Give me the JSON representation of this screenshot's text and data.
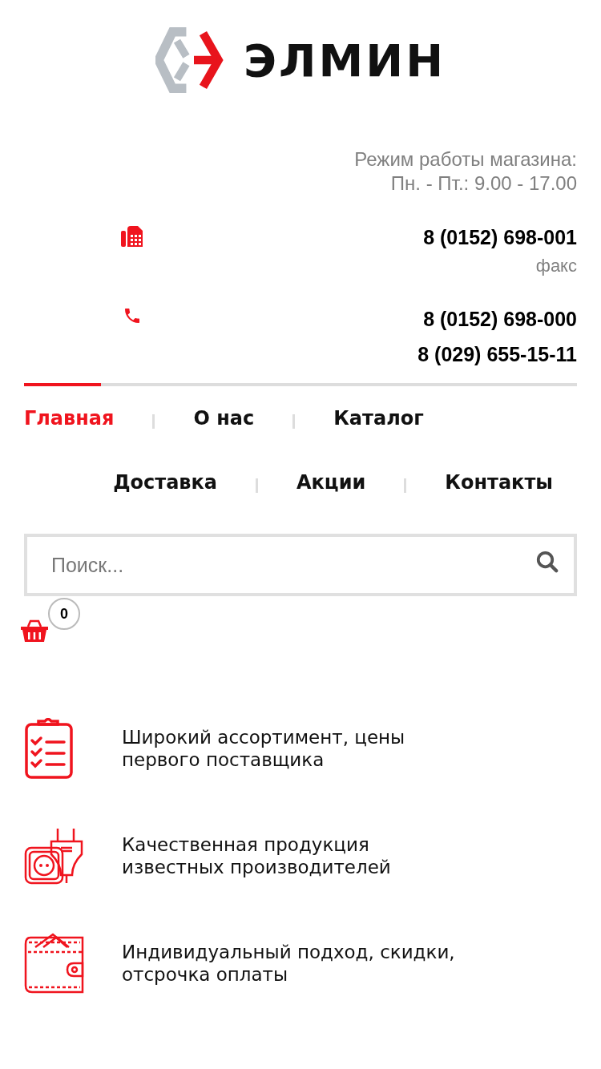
{
  "logo": {
    "text": "ЭЛМИН"
  },
  "hours": {
    "label": "Режим работы магазина:",
    "value": "Пн. - Пт.: 9.00 - 17.00"
  },
  "contacts": [
    {
      "kind": "fax",
      "numbers": [
        "8 (0152) 698-001"
      ],
      "note": "факс"
    },
    {
      "kind": "phone",
      "numbers": [
        "8 (0152) 698-000",
        "8 (029) 655-15-11"
      ]
    }
  ],
  "nav": [
    {
      "label": "Главная",
      "selected": true
    },
    {
      "label": "О нас",
      "selected": false
    },
    {
      "label": "Каталог",
      "selected": false
    },
    {
      "label": "Доставка",
      "selected": false
    },
    {
      "label": "Акции",
      "selected": false
    },
    {
      "label": "Контакты",
      "selected": false
    }
  ],
  "search": {
    "placeholder": "Поиск..."
  },
  "cart": {
    "count": "0"
  },
  "features": [
    {
      "kind": "checklist",
      "text": "Широкий ассортимент, цены первого поставщика"
    },
    {
      "kind": "plug",
      "text": "Качественная продукция известных производителей"
    },
    {
      "kind": "wallet",
      "text": "Индивидуальный подход, скидки, отсрочка оплаты"
    }
  ]
}
